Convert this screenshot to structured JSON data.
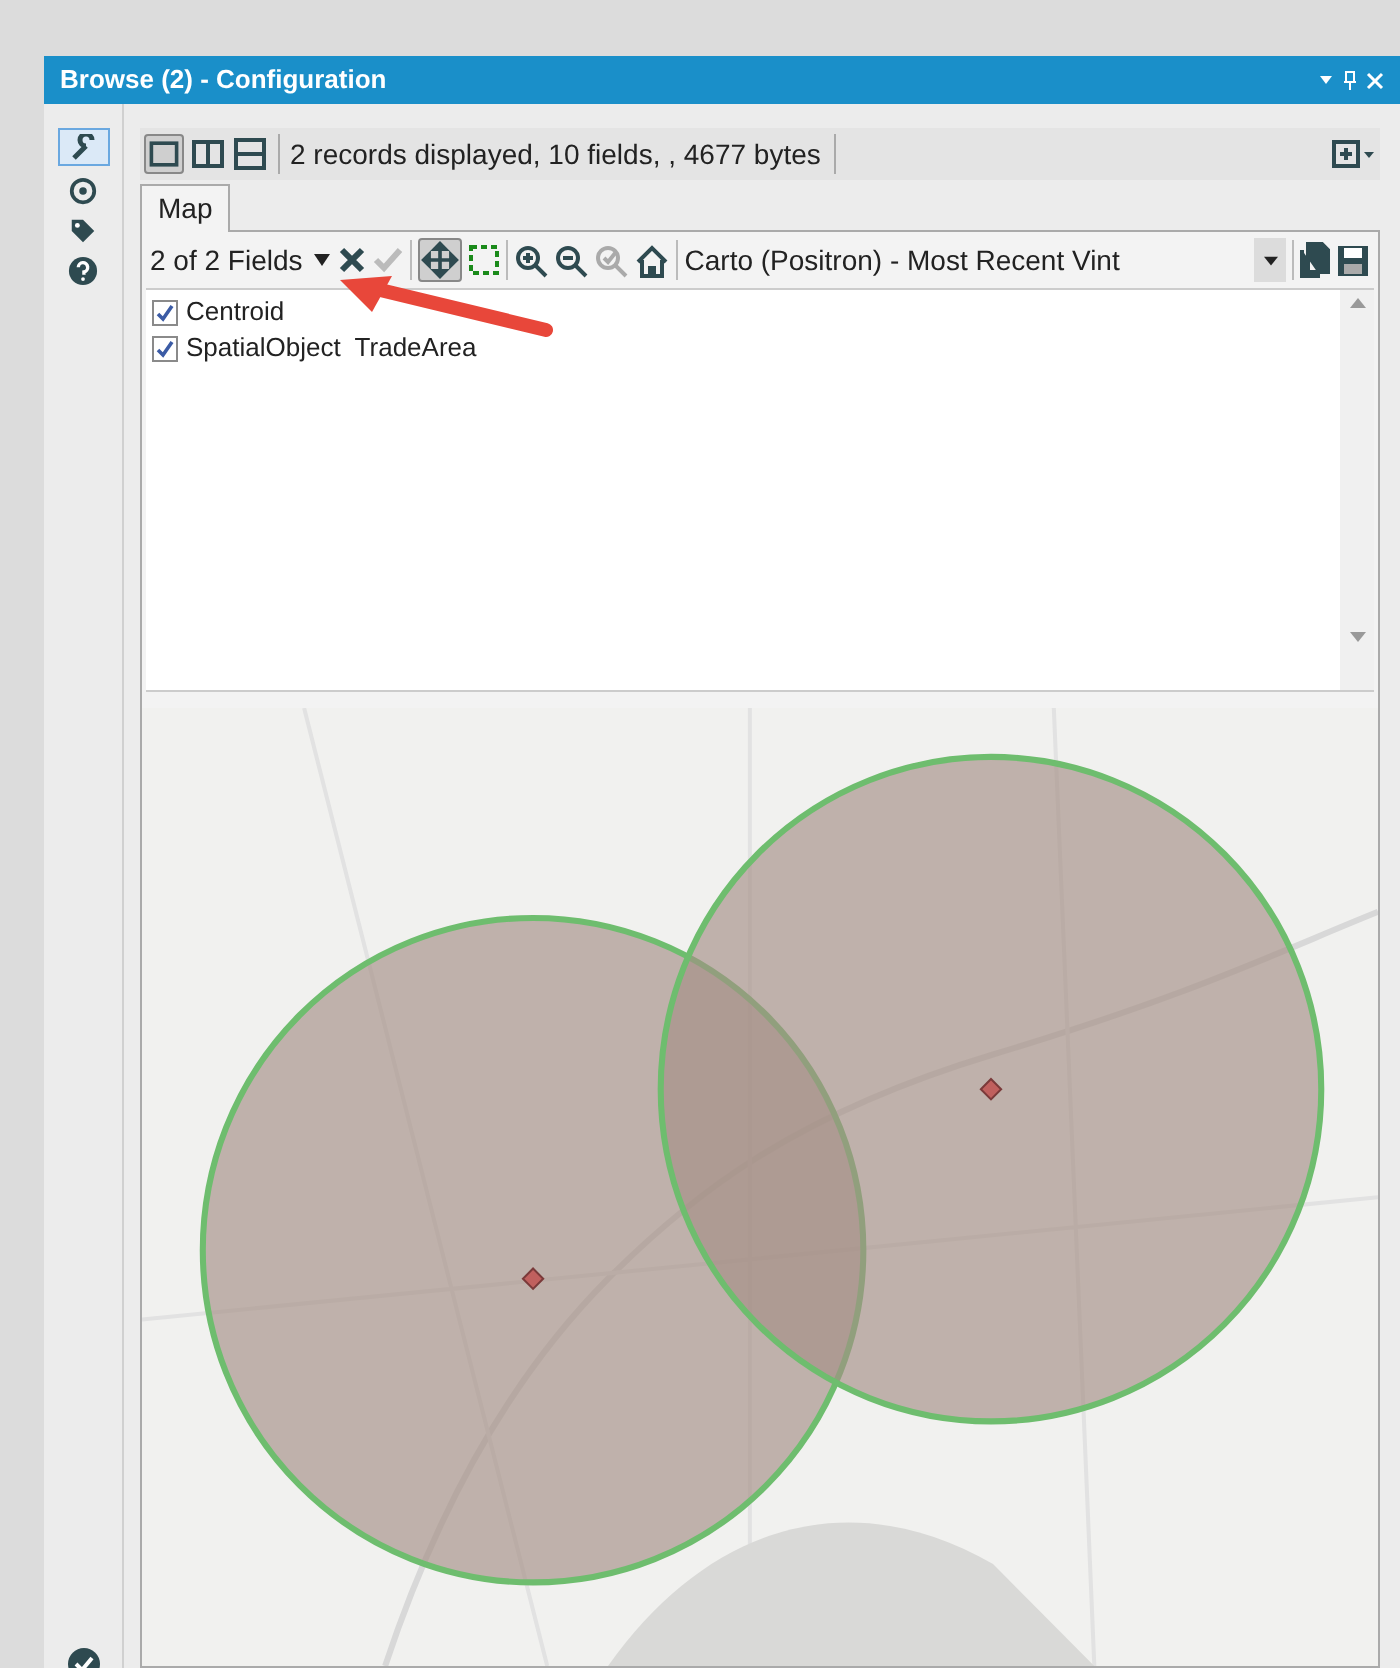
{
  "window": {
    "title": "Browse (2) - Configuration"
  },
  "status": {
    "text": "2 records displayed, 10 fields, , 4677 bytes"
  },
  "tabs": [
    {
      "label": "Map",
      "selected": true
    }
  ],
  "map_toolbar": {
    "fields_dropdown": "2 of 2 Fields",
    "basemap": "Carto (Positron) - Most Recent Vint"
  },
  "fields": [
    {
      "label": "Centroid",
      "checked": true
    },
    {
      "label": "SpatialObject  TradeArea",
      "checked": true
    }
  ]
}
